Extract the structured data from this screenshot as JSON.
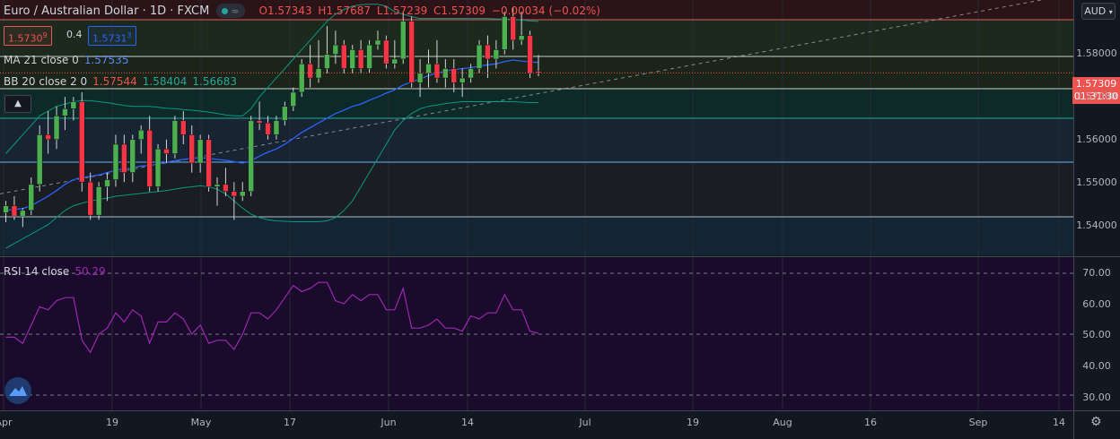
{
  "header": {
    "symbol": "Euro / Australian Dollar · 1D · FXCM",
    "open": "O1.57343",
    "high": "H1.57687",
    "low": "L1.57239",
    "close": "C1.57309",
    "change": "−0.00034 (−0.02%)"
  },
  "trade": {
    "sell_price": "1.5730",
    "sell_sup": "9",
    "spread": "0.4",
    "buy_price": "1.5731",
    "buy_sup": "3"
  },
  "indicators": {
    "ma": {
      "label": "MA 21 close 0",
      "value": "1.57535"
    },
    "bb": {
      "label": "BB 20 close 2 0",
      "v1": "1.57544",
      "v2": "1.58404",
      "v3": "1.56683"
    },
    "rsi": {
      "label": "RSI 14 close",
      "value": "50.29"
    }
  },
  "currency_button": "AUD",
  "last_price": "1.57309",
  "countdown": "01:31:30",
  "price_axis": [
    "1.58000",
    "1.57000",
    "1.56000",
    "1.55000",
    "1.54000"
  ],
  "rsi_axis": [
    "70.00",
    "60.00",
    "50.00",
    "40.00",
    "30.00"
  ],
  "time_axis": [
    "Apr",
    "19",
    "May",
    "17",
    "Jun",
    "14",
    "Jul",
    "19",
    "Aug",
    "16",
    "Sep",
    "14"
  ],
  "colors": {
    "up": "#26a69a",
    "candle_up": "#4caf50",
    "candle_down": "#f23645",
    "ma": "#2962ff",
    "bb": "#089981",
    "rsi": "#9c27b0",
    "background": "#131722"
  },
  "chart_data": {
    "type": "candlestick",
    "price_ylim": [
      1.5345,
      1.5885
    ],
    "rsi_ylim": [
      25,
      75
    ],
    "candles": [
      [
        1.5435,
        1.546,
        1.5415,
        1.545
      ],
      [
        1.545,
        1.547,
        1.542,
        1.5428
      ],
      [
        1.5428,
        1.5445,
        1.5405,
        1.544
      ],
      [
        1.544,
        1.551,
        1.543,
        1.5495
      ],
      [
        1.5495,
        1.562,
        1.548,
        1.56
      ],
      [
        1.56,
        1.565,
        1.556,
        1.559
      ],
      [
        1.559,
        1.566,
        1.557,
        1.564
      ],
      [
        1.564,
        1.568,
        1.561,
        1.5655
      ],
      [
        1.5655,
        1.568,
        1.563,
        1.567
      ],
      [
        1.567,
        1.569,
        1.548,
        1.55
      ],
      [
        1.55,
        1.552,
        1.542,
        1.543
      ],
      [
        1.543,
        1.55,
        1.542,
        1.549
      ],
      [
        1.549,
        1.552,
        1.546,
        1.5505
      ],
      [
        1.5505,
        1.56,
        1.549,
        1.558
      ],
      [
        1.558,
        1.56,
        1.55,
        1.552
      ],
      [
        1.552,
        1.56,
        1.55,
        1.559
      ],
      [
        1.559,
        1.562,
        1.556,
        1.561
      ],
      [
        1.561,
        1.564,
        1.548,
        1.549
      ],
      [
        1.549,
        1.558,
        1.548,
        1.557
      ],
      [
        1.557,
        1.559,
        1.554,
        1.556
      ],
      [
        1.556,
        1.564,
        1.555,
        1.563
      ],
      [
        1.563,
        1.565,
        1.558,
        1.56
      ],
      [
        1.56,
        1.562,
        1.552,
        1.554
      ],
      [
        1.554,
        1.56,
        1.552,
        1.559
      ],
      [
        1.559,
        1.56,
        1.548,
        1.549
      ],
      [
        1.549,
        1.551,
        1.545,
        1.5495
      ],
      [
        1.5495,
        1.553,
        1.547,
        1.548
      ],
      [
        1.548,
        1.55,
        1.542,
        1.547
      ],
      [
        1.547,
        1.55,
        1.546,
        1.548
      ],
      [
        1.548,
        1.564,
        1.547,
        1.563
      ],
      [
        1.563,
        1.567,
        1.561,
        1.5625
      ],
      [
        1.5625,
        1.564,
        1.559,
        1.56
      ],
      [
        1.56,
        1.564,
        1.559,
        1.563
      ],
      [
        1.563,
        1.567,
        1.562,
        1.566
      ],
      [
        1.566,
        1.57,
        1.565,
        1.569
      ],
      [
        1.569,
        1.576,
        1.568,
        1.575
      ],
      [
        1.575,
        1.579,
        1.57,
        1.572
      ],
      [
        1.572,
        1.58,
        1.571,
        1.574
      ],
      [
        1.574,
        1.583,
        1.573,
        1.577
      ],
      [
        1.577,
        1.582,
        1.575,
        1.579
      ],
      [
        1.579,
        1.58,
        1.573,
        1.574
      ],
      [
        1.574,
        1.579,
        1.573,
        1.578
      ],
      [
        1.578,
        1.58,
        1.573,
        1.574
      ],
      [
        1.574,
        1.58,
        1.573,
        1.579
      ],
      [
        1.579,
        1.582,
        1.578,
        1.58
      ],
      [
        1.58,
        1.581,
        1.574,
        1.575
      ],
      [
        1.575,
        1.58,
        1.574,
        1.576
      ],
      [
        1.576,
        1.586,
        1.575,
        1.584
      ],
      [
        1.584,
        1.585,
        1.57,
        1.571
      ],
      [
        1.571,
        1.576,
        1.568,
        1.573
      ],
      [
        1.573,
        1.578,
        1.57,
        1.575
      ],
      [
        1.575,
        1.58,
        1.571,
        1.572
      ],
      [
        1.572,
        1.576,
        1.57,
        1.574
      ],
      [
        1.574,
        1.576,
        1.569,
        1.571
      ],
      [
        1.571,
        1.574,
        1.568,
        1.572
      ],
      [
        1.572,
        1.575,
        1.571,
        1.574
      ],
      [
        1.574,
        1.58,
        1.573,
        1.579
      ],
      [
        1.579,
        1.581,
        1.572,
        1.576
      ],
      [
        1.576,
        1.58,
        1.574,
        1.578
      ],
      [
        1.578,
        1.586,
        1.577,
        1.585
      ],
      [
        1.585,
        1.587,
        1.578,
        1.58
      ],
      [
        1.58,
        1.586,
        1.579,
        1.581
      ],
      [
        1.581,
        1.582,
        1.572,
        1.573
      ],
      [
        1.57343,
        1.57687,
        1.57239,
        1.57309
      ]
    ],
    "ma21": [
      1.544,
      1.5442,
      1.5444,
      1.545,
      1.546,
      1.547,
      1.5482,
      1.5495,
      1.5505,
      1.551,
      1.5512,
      1.5515,
      1.552,
      1.5525,
      1.5528,
      1.553,
      1.5534,
      1.5535,
      1.5538,
      1.5542,
      1.5545,
      1.5548,
      1.555,
      1.5552,
      1.555,
      1.5548,
      1.5546,
      1.5543,
      1.554,
      1.5545,
      1.5555,
      1.5563,
      1.557,
      1.558,
      1.5592,
      1.5605,
      1.5615,
      1.5625,
      1.5635,
      1.5645,
      1.5652,
      1.566,
      1.5665,
      1.5673,
      1.568,
      1.5688,
      1.5695,
      1.5705,
      1.5712,
      1.5718,
      1.5725,
      1.573,
      1.5735,
      1.5738,
      1.574,
      1.5742,
      1.5745,
      1.5748,
      1.575,
      1.5755,
      1.5758,
      1.5756,
      1.5754,
      1.5753
    ],
    "bb_upper": [
      1.556,
      1.558,
      1.56,
      1.562,
      1.564,
      1.565,
      1.566,
      1.5665,
      1.567,
      1.5672,
      1.5672,
      1.567,
      1.5668,
      1.5665,
      1.5662,
      1.566,
      1.566,
      1.566,
      1.5658,
      1.5656,
      1.5655,
      1.5653,
      1.5652,
      1.565,
      1.5648,
      1.5645,
      1.5642,
      1.564,
      1.564,
      1.5655,
      1.568,
      1.57,
      1.572,
      1.574,
      1.576,
      1.578,
      1.58,
      1.582,
      1.584,
      1.5855,
      1.5865,
      1.5872,
      1.5875,
      1.5876,
      1.5876,
      1.5872,
      1.586,
      1.5855,
      1.585,
      1.5846,
      1.5846,
      1.5846,
      1.5846,
      1.5846,
      1.5846,
      1.5846,
      1.5846,
      1.5846,
      1.5845,
      1.5845,
      1.5844,
      1.5843,
      1.5841,
      1.584
    ],
    "bb_lower": [
      1.536,
      1.537,
      1.538,
      1.539,
      1.54,
      1.541,
      1.5425,
      1.544,
      1.545,
      1.5455,
      1.546,
      1.5463,
      1.5466,
      1.547,
      1.5472,
      1.5474,
      1.5476,
      1.5478,
      1.548,
      1.5482,
      1.5485,
      1.5488,
      1.549,
      1.5492,
      1.549,
      1.5485,
      1.5475,
      1.546,
      1.5445,
      1.5432,
      1.5425,
      1.542,
      1.5418,
      1.5417,
      1.5416,
      1.5416,
      1.5416,
      1.5416,
      1.5418,
      1.5425,
      1.544,
      1.546,
      1.549,
      1.552,
      1.555,
      1.558,
      1.561,
      1.563,
      1.5645,
      1.5655,
      1.566,
      1.5663,
      1.5666,
      1.5668,
      1.567,
      1.567,
      1.567,
      1.567,
      1.567,
      1.567,
      1.567,
      1.5669,
      1.5668,
      1.5668
    ],
    "rsi": [
      49,
      49,
      47,
      53,
      59,
      58,
      61,
      62,
      62,
      48,
      44,
      50,
      52,
      57,
      54,
      58,
      56,
      47,
      54,
      54,
      57,
      55,
      50,
      53,
      47,
      48,
      48,
      45,
      50,
      57,
      57,
      55,
      58,
      62,
      66,
      64,
      65,
      67,
      67,
      61,
      60,
      63,
      61,
      63,
      63,
      58,
      58,
      65,
      52,
      52,
      53,
      55,
      52,
      52,
      51,
      56,
      55,
      57,
      57,
      63,
      58,
      58,
      51,
      50.29
    ]
  }
}
